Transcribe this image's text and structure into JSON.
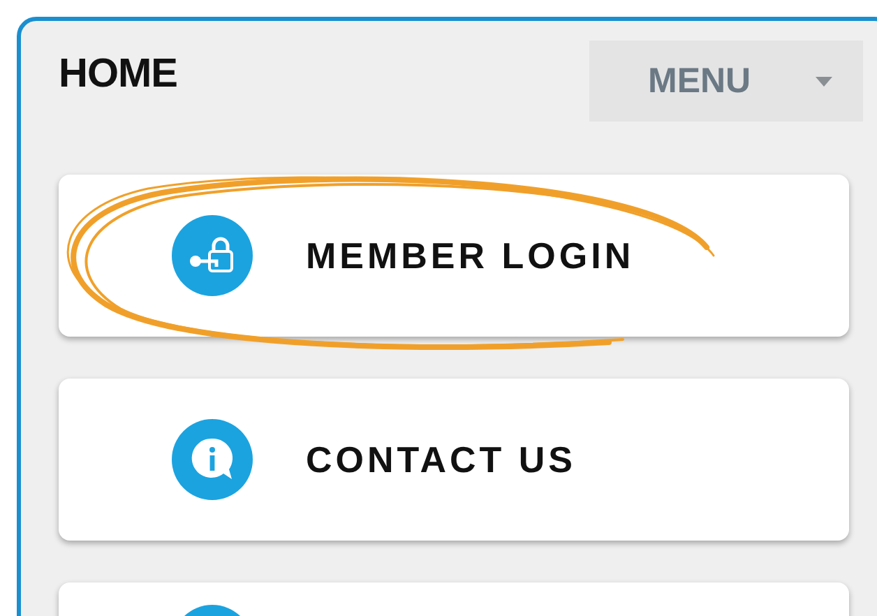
{
  "header": {
    "title": "HOME",
    "menu_button": {
      "label": "MENU"
    }
  },
  "cards": [
    {
      "kind": "lock",
      "label": "MEMBER LOGIN",
      "highlighted": true
    },
    {
      "kind": "info",
      "label": "CONTACT US",
      "highlighted": false
    },
    {
      "kind": "partial",
      "highlighted": false
    }
  ]
}
